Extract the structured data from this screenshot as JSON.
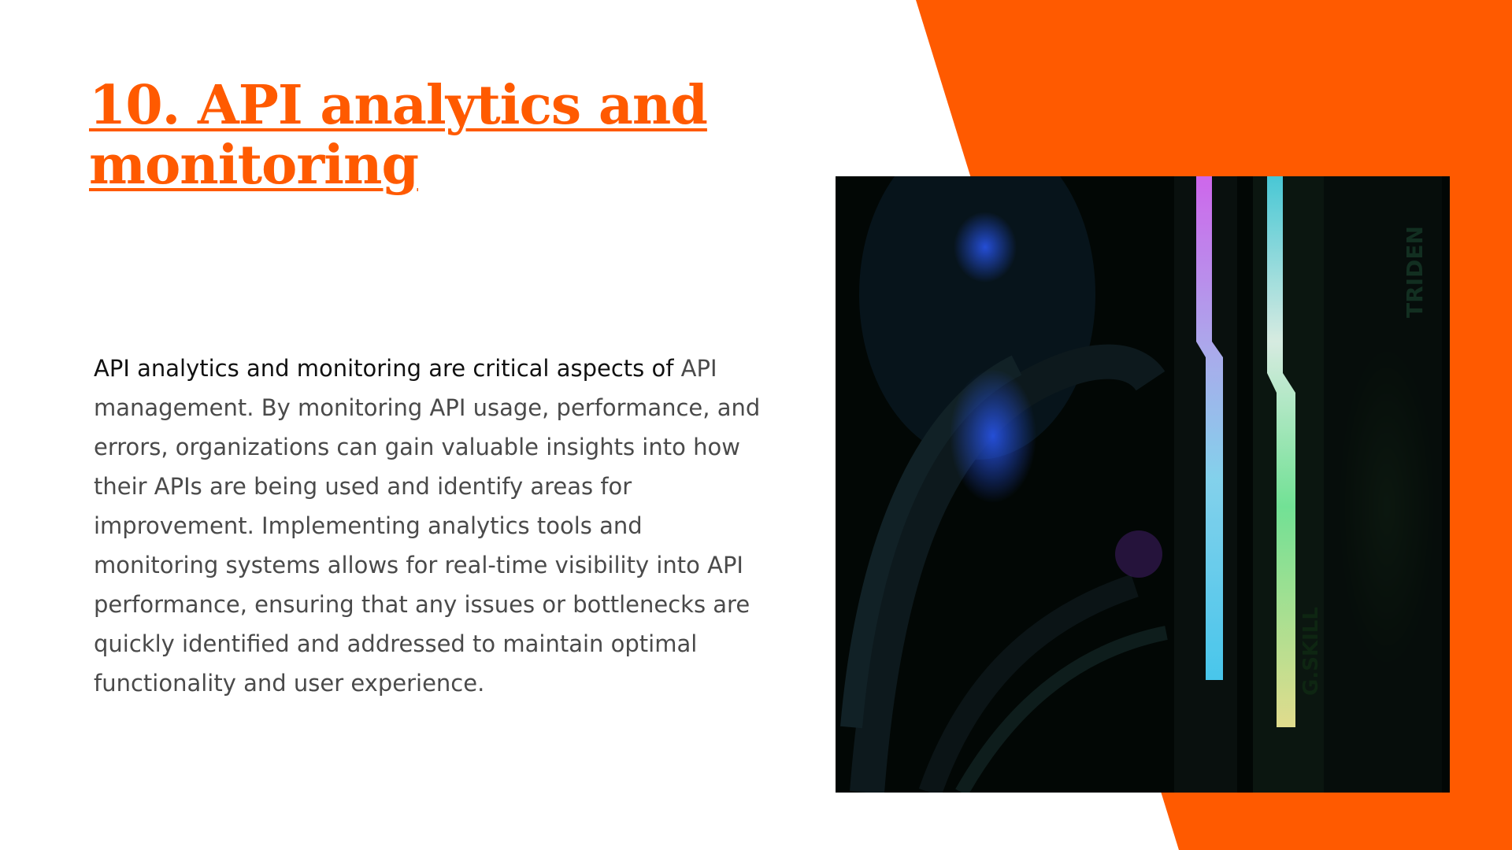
{
  "colors": {
    "accent": "#FF5A00",
    "background": "#FFFFFF",
    "body_text": "#4A4A4A",
    "body_lead_text": "#111111"
  },
  "slide": {
    "title": "10. API analytics and monitoring",
    "body_lead": "API analytics and monitoring are critical aspects of",
    "body_rest": " API management. By monitoring API usage, performance, and errors, organizations can gain valuable insights into how their APIs are being used and identify areas for improvement. Implementing analytics tools and monitoring systems allows for real-time visibility into API performance, ensuring that any issues or bottlenecks are quickly identified and addressed to maintain optimal functionality and user experience."
  },
  "photo": {
    "subject": "rgb-ram-modules",
    "module_brand": "G.SKILL",
    "side_text": "TRIDEN"
  }
}
